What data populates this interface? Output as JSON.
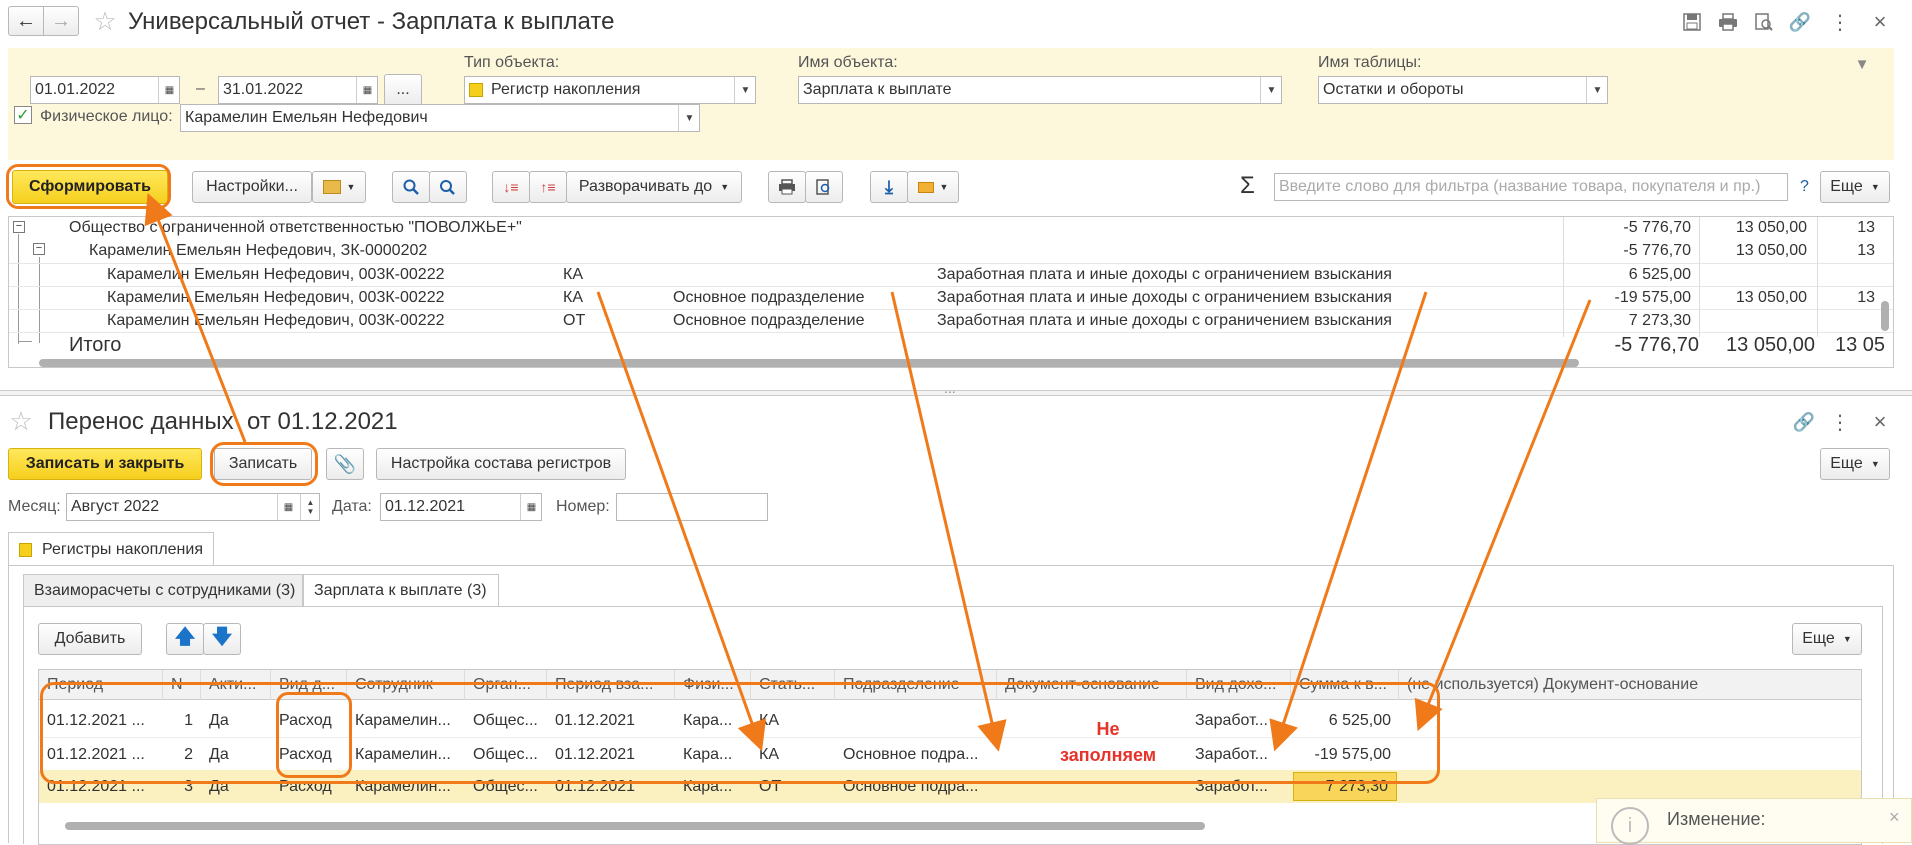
{
  "top_window": {
    "title": "Универсальный отчет - Зарплата к выплате",
    "period_from": "01.01.2022",
    "period_dash": "–",
    "period_to": "31.01.2022",
    "more_btn": "...",
    "object_type_label": "Тип объекта:",
    "object_type_value": "Регистр накопления",
    "object_name_label": "Имя объекта:",
    "object_name_value": "Зарплата к выплате",
    "table_name_label": "Имя таблицы:",
    "table_name_value": "Остатки и обороты",
    "person_label": "Физическое лицо:",
    "person_value": "Карамелин Емельян Нефедович",
    "generate_btn": "Сформировать",
    "settings_btn": "Настройки...",
    "expand_btn": "Разворачивать до",
    "sigma": "Σ",
    "filter_placeholder": "Введите слово для фильтра (название товара, покупателя и пр.)",
    "help": "?",
    "more_menu": "Еще",
    "report_rows": [
      {
        "c1": "Общество с ограниченной ответственностью \"ПОВОЛЖЬЕ+\"",
        "c2": "",
        "c3": "",
        "c4": "",
        "v1": "-5 776,70",
        "v2": "13 050,00",
        "v3": "13"
      },
      {
        "c1": "Карамелин Емельян Нефедович, ЗК-0000202",
        "c2": "",
        "c3": "",
        "c4": "",
        "v1": "-5 776,70",
        "v2": "13 050,00",
        "v3": "13"
      },
      {
        "c1": "Карамелин Емельян Нефедович, 003К-00222",
        "c2": "КА",
        "c3": "",
        "c4": "Заработная плата и иные доходы с ограничением взыскания",
        "v1": "6 525,00",
        "v2": "",
        "v3": ""
      },
      {
        "c1": "Карамелин Емельян Нефедович, 003К-00222",
        "c2": "КА",
        "c3": "Основное подразделение",
        "c4": "Заработная плата и иные доходы с ограничением взыскания",
        "v1": "-19 575,00",
        "v2": "13 050,00",
        "v3": "13"
      },
      {
        "c1": "Карамелин Емельян Нефедович, 003К-00222",
        "c2": "ОТ",
        "c3": "Основное подразделение",
        "c4": "Заработная плата и иные доходы с ограничением взыскания",
        "v1": "7 273,30",
        "v2": "",
        "v3": ""
      }
    ],
    "total_label": "Итого",
    "total_v1": "-5 776,70",
    "total_v2": "13 050,00",
    "total_v3": "13 05"
  },
  "splitter": "...",
  "bottom_window": {
    "title": "Перенос данных  от 01.12.2021",
    "save_close_btn": "Записать и закрыть",
    "save_btn": "Записать",
    "registers_btn": "Настройка состава регистров",
    "more_menu": "Еще",
    "month_label": "Месяц:",
    "month_value": "Август 2022",
    "date_label": "Дата:",
    "date_value": "01.12.2021",
    "number_label": "Номер:",
    "number_value": "",
    "outer_tab": "Регистры накопления",
    "tab1": "Взаиморасчеты с сотрудниками (3)",
    "tab2": "Зарплата к выплате (3)",
    "add_btn": "Добавить",
    "grid_more": "Еще",
    "columns": [
      "Период",
      "N",
      "Акти...",
      "Вид д...",
      "Сотрудник",
      "Орган...",
      "Период вза...",
      "Физи...",
      "Стать...",
      "Подразделение",
      "Документ-основание",
      "Вид дохо...",
      "Сумма к в...",
      "(не используется) Документ-основание"
    ],
    "rows": [
      [
        "01.12.2021 ...",
        "1",
        "Да",
        "Расход",
        "Карамелин...",
        "Общес...",
        "01.12.2021",
        "Кара...",
        "КА",
        "",
        "",
        "Заработ...",
        "6 525,00",
        ""
      ],
      [
        "01.12.2021 ...",
        "2",
        "Да",
        "Расход",
        "Карамелин...",
        "Общес...",
        "01.12.2021",
        "Кара...",
        "КА",
        "Основное подра...",
        "",
        "Заработ...",
        "-19 575,00",
        ""
      ],
      [
        "01.12.2021 ...",
        "3",
        "Да",
        "Расход",
        "Карамелин...",
        "Общес...",
        "01.12.2021",
        "Кара...",
        "ОТ",
        "Основное подра...",
        "",
        "Заработ...",
        "7 273,30",
        ""
      ]
    ],
    "annotation": "Не\nзаполняем",
    "notification": "Изменение:"
  },
  "colors": {
    "accent_yellow": "#f6cf1d",
    "filter_bg": "#fdf8dc",
    "annotation_orange": "#f07a1a",
    "annotation_red": "#e8332a",
    "selected_row": "#fbf0c0"
  }
}
